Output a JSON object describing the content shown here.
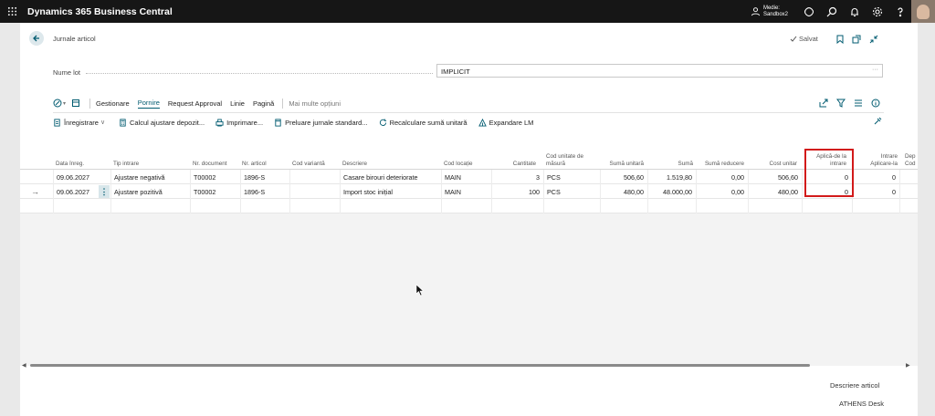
{
  "app": {
    "title": "Dynamics 365 Business Central",
    "environment_line1": "Medie:",
    "environment_line2": "Sandbox2"
  },
  "page": {
    "title": "Jurnale articol",
    "saved_label": "Salvat"
  },
  "batch": {
    "label": "Nume lot",
    "value": "IMPLICIT"
  },
  "actions": {
    "tabs": [
      "Gestionare",
      "Pornire",
      "Request Approval",
      "Linie",
      "Pagină"
    ],
    "active_tab": "Pornire",
    "more": "Mai multe opțiuni"
  },
  "subactions": {
    "post": "Înregistrare",
    "calc_adjust": "Calcul ajustare depozit...",
    "print": "Imprimare...",
    "get_std": "Preluare jurnale standard...",
    "recalc": "Recalculare sumă unitară",
    "explode_bom": "Expandare LM"
  },
  "grid": {
    "headers": {
      "posting_date": "Data înreg.",
      "entry_type": "Tip intrare",
      "doc_no": "Nr. document",
      "item_no": "Nr. articol",
      "variant": "Cod variantă",
      "description": "Descriere",
      "location": "Cod locație",
      "quantity": "Cantitate",
      "uom_1": "Cod unitate de",
      "uom_2": "măsură",
      "unit_amount": "Sumă unitară",
      "amount": "Sumă",
      "discount": "Sumă reducere",
      "unit_cost": "Cost unitar",
      "applies_from_1": "Aplică-de la",
      "applies_from_2": "intrare",
      "applies_to_1": "Intrare",
      "applies_to_2": "Aplicare-la",
      "dep_1": "Dep",
      "dep_2": "Cod"
    },
    "rows": [
      {
        "posting_date": "09.06.2027",
        "entry_type": "Ajustare negativă",
        "doc_no": "T00002",
        "item_no": "1896-S",
        "variant": "",
        "description": "Casare birouri deteriorate",
        "location": "MAIN",
        "quantity": "3",
        "uom": "PCS",
        "unit_amount": "506,60",
        "amount": "1.519,80",
        "discount": "0,00",
        "unit_cost": "506,60",
        "applies_from": "0",
        "applies_to": "0"
      },
      {
        "posting_date": "09.06.2027",
        "entry_type": "Ajustare pozitivă",
        "doc_no": "T00002",
        "item_no": "1896-S",
        "variant": "",
        "description": "Import stoc inițial",
        "location": "MAIN",
        "quantity": "100",
        "uom": "PCS",
        "unit_amount": "480,00",
        "amount": "48.000,00",
        "discount": "0,00",
        "unit_cost": "480,00",
        "applies_from": "0",
        "applies_to": "0"
      }
    ]
  },
  "factbox": {
    "item_description": "Descriere articol",
    "item_value": "ATHENS Desk"
  },
  "colors": {
    "topbar": "#161616",
    "accent": "#005b70",
    "highlight": "#d21a1a"
  }
}
